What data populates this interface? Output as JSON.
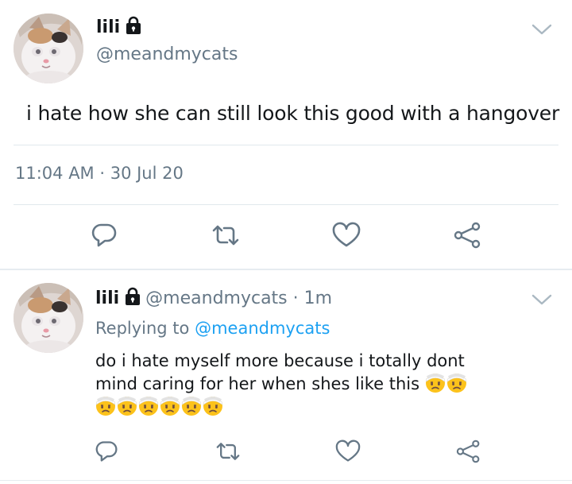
{
  "main_tweet": {
    "name": "lili",
    "handle": "@meandmycats",
    "text": "i hate how she can still look this good with a hangover",
    "time": "11:04 AM · 30 Jul 20"
  },
  "reply_tweet": {
    "name": "lili",
    "handle": "@meandmycats",
    "time_sep": " · ",
    "time": "1m",
    "replying_prefix": "Replying to ",
    "replying_to": "@meandmycats",
    "text_line1": "do i hate myself more because i totally dont",
    "text_line2": "mind caring for her when shes like this ",
    "emoji_name": "face-with-head-bandage",
    "emoji_count": 8
  },
  "icons": {
    "reply": "reply-icon",
    "retweet": "retweet-icon",
    "like": "heart-icon",
    "share": "share-icon",
    "lock": "lock-icon",
    "more": "chevron-down-icon"
  },
  "colors": {
    "text": "#14171a",
    "secondary": "#657786",
    "link": "#1da1f2",
    "divider": "#e1e8ed"
  }
}
